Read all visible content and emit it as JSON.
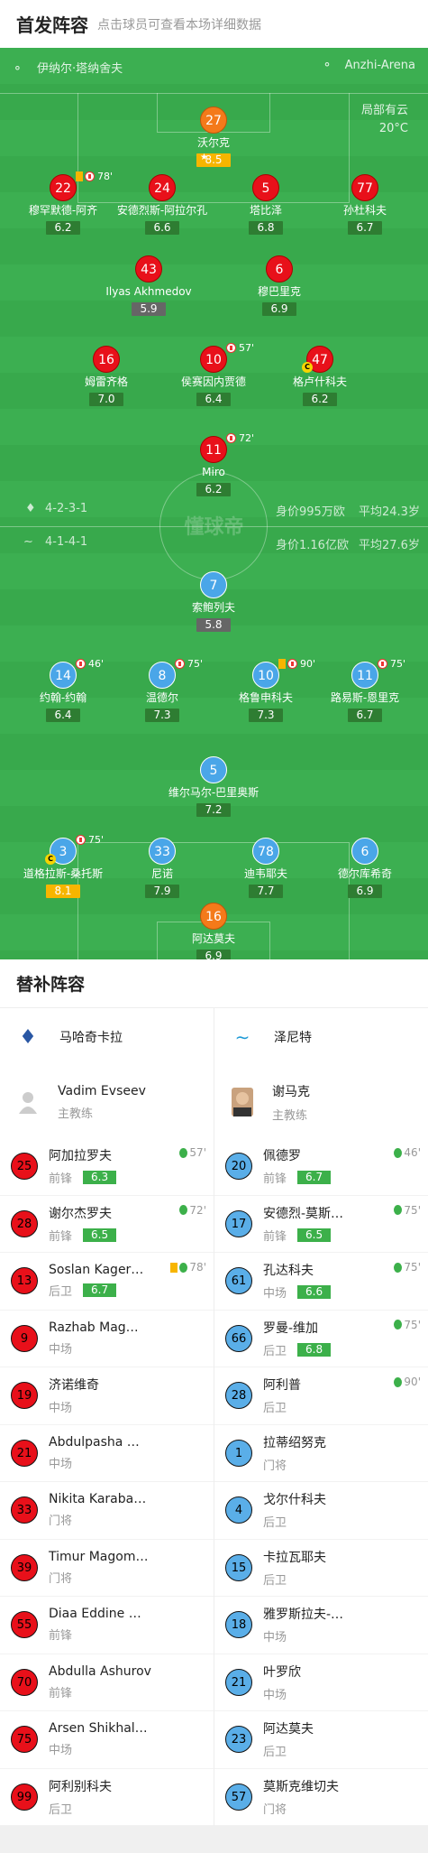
{
  "header": {
    "title": "首发阵容",
    "subtitle": "点击球员可查看本场详细数据"
  },
  "pitch": {
    "team_home": "伊纳尔·塔纳舍夫",
    "stadium": "Anzhi-Arena",
    "weather": "局部有云",
    "temp": "20°C",
    "watermark": "懂球帝",
    "home_formation": "4-2-3-1",
    "home_value": "身价995万欧",
    "home_age": "平均24.3岁",
    "away_formation": "4-1-4-1",
    "away_value": "身价1.16亿欧",
    "away_age": "平均27.6岁"
  },
  "home_players": [
    {
      "num": "27",
      "name": "沃尔克",
      "rating": "8.5",
      "rtype": "y",
      "star": true,
      "color": "org"
    },
    {
      "num": "22",
      "name": "穆罕默德-阿齐",
      "rating": "6.2",
      "rtype": "g",
      "yc": true,
      "ev": "78'",
      "color": "red"
    },
    {
      "num": "24",
      "name": "安德烈斯-阿拉尔孔",
      "rating": "6.6",
      "rtype": "g",
      "color": "red"
    },
    {
      "num": "5",
      "name": "塔比泽",
      "rating": "6.8",
      "rtype": "g",
      "color": "red"
    },
    {
      "num": "77",
      "name": "孙杜科夫",
      "rating": "6.7",
      "rtype": "g",
      "color": "red"
    },
    {
      "num": "43",
      "name": "Ilyas Akhmedov",
      "rating": "5.9",
      "rtype": "gr",
      "color": "red"
    },
    {
      "num": "6",
      "name": "穆巴里克",
      "rating": "6.9",
      "rtype": "g",
      "color": "red"
    },
    {
      "num": "16",
      "name": "姆雷齐格",
      "rating": "7.0",
      "rtype": "g",
      "color": "red"
    },
    {
      "num": "10",
      "name": "侯赛因内贾德",
      "rating": "6.4",
      "rtype": "g",
      "ev": "57'",
      "color": "red"
    },
    {
      "num": "47",
      "name": "格卢什科夫",
      "rating": "6.2",
      "rtype": "g",
      "cap": "C",
      "color": "red"
    },
    {
      "num": "11",
      "name": "Miro",
      "rating": "6.2",
      "rtype": "g",
      "ev": "72'",
      "color": "red"
    }
  ],
  "away_players": [
    {
      "num": "7",
      "name": "索鲍列夫",
      "rating": "5.8",
      "rtype": "gr",
      "color": "blue"
    },
    {
      "num": "14",
      "name": "约翰-约翰",
      "rating": "6.4",
      "rtype": "g",
      "ev": "46'",
      "color": "blue"
    },
    {
      "num": "8",
      "name": "温德尔",
      "rating": "7.3",
      "rtype": "g",
      "ev": "75'",
      "color": "blue"
    },
    {
      "num": "10",
      "name": "格鲁申科夫",
      "rating": "7.3",
      "rtype": "g",
      "yc": true,
      "ev": "90'",
      "color": "blue"
    },
    {
      "num": "11",
      "name": "路易斯-恩里克",
      "rating": "6.7",
      "rtype": "g",
      "ev": "75'",
      "color": "blue"
    },
    {
      "num": "5",
      "name": "维尔马尔-巴里奥斯",
      "rating": "7.2",
      "rtype": "g",
      "color": "blue"
    },
    {
      "num": "3",
      "name": "道格拉斯-桑托斯",
      "rating": "8.1",
      "rtype": "y",
      "cap": "C",
      "ev": "75'",
      "color": "blue"
    },
    {
      "num": "33",
      "name": "尼诺",
      "rating": "7.9",
      "rtype": "g",
      "color": "blue"
    },
    {
      "num": "78",
      "name": "迪韦耶夫",
      "rating": "7.7",
      "rtype": "g",
      "color": "blue"
    },
    {
      "num": "6",
      "name": "德尔库希奇",
      "rating": "6.9",
      "rtype": "g",
      "color": "blue"
    },
    {
      "num": "16",
      "name": "阿达莫夫",
      "rating": "6.9",
      "rtype": "g",
      "color": "org"
    }
  ],
  "subs": {
    "title": "替补阵容",
    "home_team": "马哈奇卡拉",
    "away_team": "泽尼特",
    "home_coach": {
      "name": "Vadim Evseev",
      "role": "主教练"
    },
    "away_coach": {
      "name": "谢马克",
      "role": "主教练"
    },
    "home": [
      {
        "num": "25",
        "name": "阿加拉罗夫",
        "pos": "前锋",
        "rating": "6.3",
        "ev": "57'"
      },
      {
        "num": "28",
        "name": "谢尔杰罗夫",
        "pos": "前锋",
        "rating": "6.5",
        "ev": "72'"
      },
      {
        "num": "13",
        "name": "Soslan Kager…",
        "pos": "后卫",
        "rating": "6.7",
        "ev": "78'",
        "yc": true
      },
      {
        "num": "9",
        "name": "Razhab Mag…",
        "pos": "中场"
      },
      {
        "num": "19",
        "name": "济诺维奇",
        "pos": "中场"
      },
      {
        "num": "21",
        "name": "Abdulpasha …",
        "pos": "中场"
      },
      {
        "num": "33",
        "name": "Nikita Karaba…",
        "pos": "门将"
      },
      {
        "num": "39",
        "name": "Timur Magom…",
        "pos": "门将"
      },
      {
        "num": "55",
        "name": "Diaa Eddine …",
        "pos": "前锋"
      },
      {
        "num": "70",
        "name": "Abdulla Ashurov",
        "pos": "前锋"
      },
      {
        "num": "75",
        "name": "Arsen Shikhal…",
        "pos": "中场"
      },
      {
        "num": "99",
        "name": "阿利别科夫",
        "pos": "后卫"
      }
    ],
    "away": [
      {
        "num": "20",
        "name": "佩德罗",
        "pos": "前锋",
        "rating": "6.7",
        "ev": "46'"
      },
      {
        "num": "17",
        "name": "安德烈-莫斯…",
        "pos": "前锋",
        "rating": "6.5",
        "ev": "75'"
      },
      {
        "num": "61",
        "name": "孔达科夫",
        "pos": "中场",
        "rating": "6.6",
        "ev": "75'"
      },
      {
        "num": "66",
        "name": "罗曼-维加",
        "pos": "后卫",
        "rating": "6.8",
        "ev": "75'"
      },
      {
        "num": "28",
        "name": "阿利普",
        "pos": "后卫",
        "ev": "90'"
      },
      {
        "num": "1",
        "name": "拉蒂绍努克",
        "pos": "门将"
      },
      {
        "num": "4",
        "name": "戈尔什科夫",
        "pos": "后卫"
      },
      {
        "num": "15",
        "name": "卡拉瓦耶夫",
        "pos": "后卫"
      },
      {
        "num": "18",
        "name": "雅罗斯拉夫-…",
        "pos": "中场"
      },
      {
        "num": "21",
        "name": "叶罗欣",
        "pos": "中场"
      },
      {
        "num": "23",
        "name": "阿达莫夫",
        "pos": "后卫"
      },
      {
        "num": "57",
        "name": "莫斯克维切夫",
        "pos": "门将"
      }
    ]
  }
}
